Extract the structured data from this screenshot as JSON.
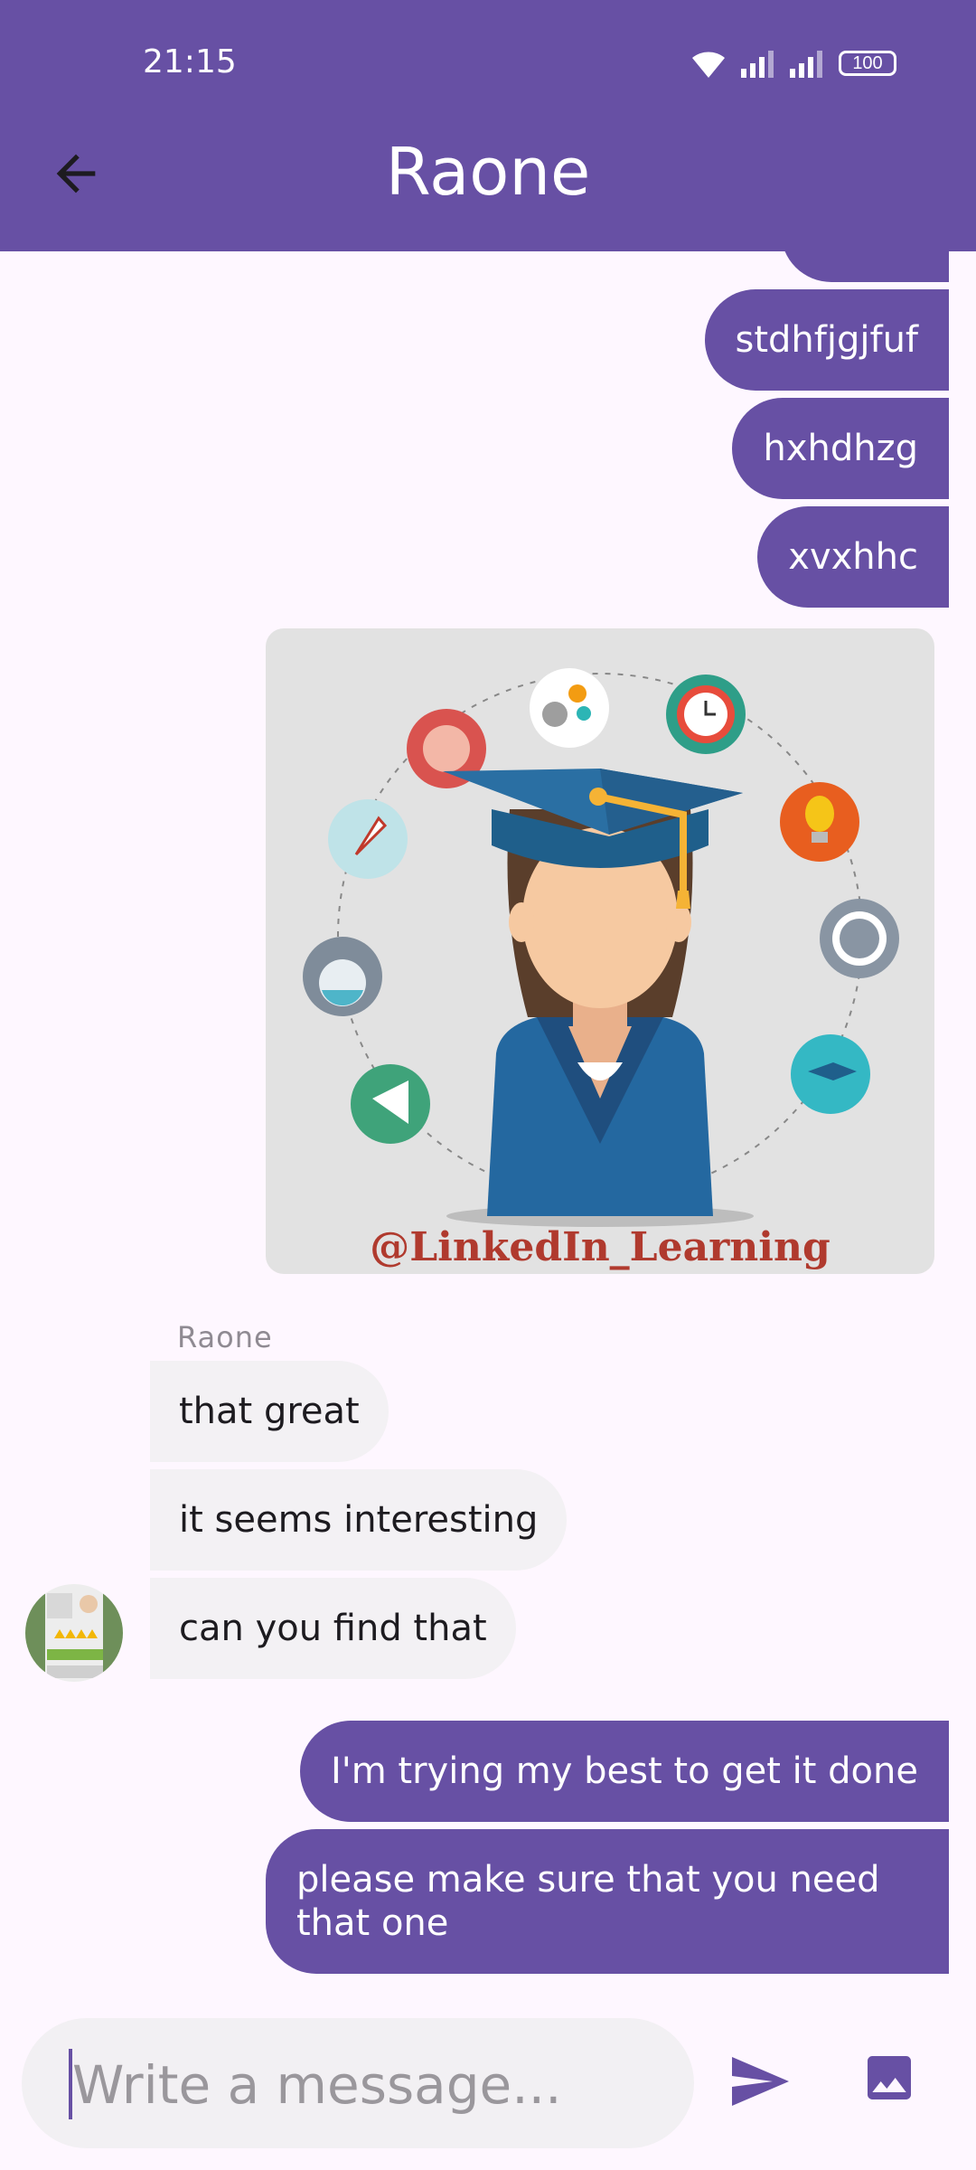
{
  "status_bar": {
    "time": "21:15",
    "battery": "100"
  },
  "header": {
    "title": "Raone"
  },
  "messages_out_top": [
    "stdhfjgjfuf",
    "hxhdhzg",
    "xvxhhc"
  ],
  "image_watermark": "@LinkedIn_Learning",
  "incoming": {
    "sender": "Raone",
    "messages": [
      "that great",
      "it seems interesting",
      "can you find that"
    ]
  },
  "messages_out_bottom": [
    "I'm trying my best to get it done",
    "please make sure that you need that one"
  ],
  "composer": {
    "placeholder": "Write a message..."
  },
  "colors": {
    "primary": "#6750A4",
    "background": "#FEF7FF",
    "incoming_bubble": "#F3F1F4"
  },
  "icons": [
    "back-arrow-icon",
    "wifi-icon",
    "signal-icon",
    "battery-icon",
    "send-icon",
    "gallery-icon"
  ]
}
